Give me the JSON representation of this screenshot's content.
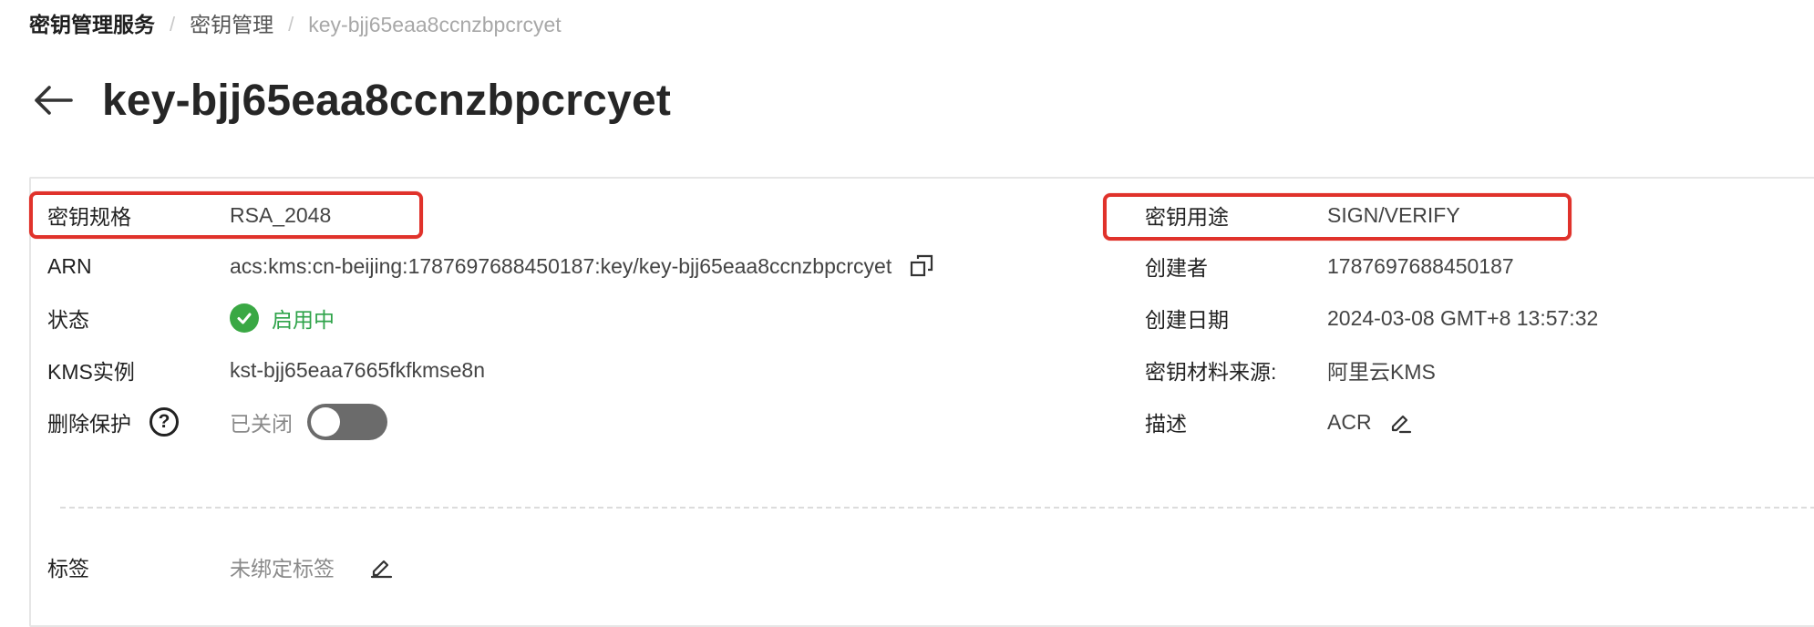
{
  "breadcrumb": {
    "root": "密钥管理服务",
    "parent": "密钥管理",
    "current": "key-bjj65eaa8ccnzbpcrcyet"
  },
  "header": {
    "title": "key-bjj65eaa8ccnzbpcrcyet",
    "back_icon": "arrow-left-icon"
  },
  "details": {
    "left": {
      "spec": {
        "label": "密钥规格",
        "value": "RSA_2048"
      },
      "arn": {
        "label": "ARN",
        "value": "acs:kms:cn-beijing:1787697688450187:key/key-bjj65eaa8ccnzbpcrcyet",
        "icon": "copy-icon"
      },
      "status": {
        "label": "状态",
        "value": "启用中",
        "icon": "check-circle-icon",
        "color": "#3aa844"
      },
      "instance": {
        "label": "KMS实例",
        "value": "kst-bjj65eaa7665fkfkmse8n"
      },
      "deletion": {
        "label": "删除保护",
        "help_icon": "question-circle-icon",
        "help_glyph": "?",
        "value": "已关闭",
        "toggle_on": false
      }
    },
    "right": {
      "usage": {
        "label": "密钥用途",
        "value": "SIGN/VERIFY"
      },
      "creator": {
        "label": "创建者",
        "value": "1787697688450187"
      },
      "created_at": {
        "label": "创建日期",
        "value": "2024-03-08 GMT+8 13:57:32"
      },
      "origin": {
        "label": "密钥材料来源:",
        "value": "阿里云KMS"
      },
      "description": {
        "label": "描述",
        "value": "ACR",
        "icon": "edit-icon"
      }
    },
    "tags": {
      "label": "标签",
      "value": "未绑定标签",
      "icon": "edit-icon"
    }
  },
  "colors": {
    "highlight": "#e0322b",
    "status_ok": "#2fa34a",
    "toggle_off": "#6b6b6b"
  }
}
